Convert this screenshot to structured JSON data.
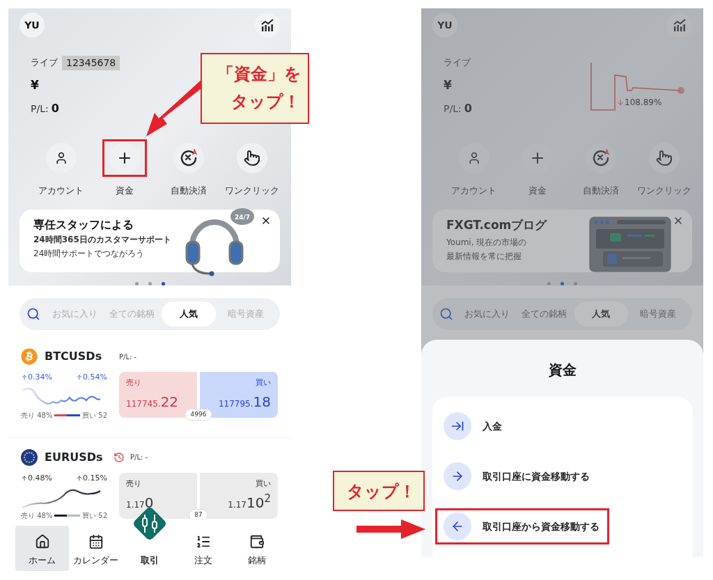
{
  "screens": [
    {
      "dimmed": false,
      "avatar": "YU",
      "account_label": "ライブ",
      "account_number": "12345678",
      "currency": "¥",
      "pl_label": "P/L:",
      "pl_value": "0",
      "actions": [
        {
          "kind": "account",
          "label": "アカウント",
          "highlighted": false
        },
        {
          "kind": "funds",
          "label": "資金",
          "highlighted": true
        },
        {
          "kind": "auto",
          "label": "自動決済",
          "highlighted": false
        },
        {
          "kind": "oneclick",
          "label": "ワンクリック",
          "highlighted": false
        }
      ],
      "banner": {
        "kind": "support",
        "title": "専任スタッフによる",
        "lines": [
          "24時間365日のカスタマーサポート",
          "24時間サポートでつながろう"
        ],
        "badge": "24/7"
      },
      "pager": [
        {
          "selected": false
        },
        {
          "selected": false
        },
        {
          "selected": true
        }
      ],
      "tabs": [
        {
          "label": "お気に入り",
          "selected": false
        },
        {
          "label": "全ての銘柄",
          "selected": false
        },
        {
          "label": "人気",
          "selected": true
        },
        {
          "label": "暗号資産",
          "selected": false
        }
      ],
      "instruments": [
        {
          "kind": "btc",
          "name": "BTCUSDs",
          "pl": "P/L: -",
          "history": false,
          "market_open": true,
          "change_1": "0.34%",
          "change_2": "0.54%",
          "sell_ratio": "売り 48%",
          "buy_ratio": "買い 52",
          "level": 0.48,
          "sell_label": "売り",
          "sell_small": "117745.",
          "sell_large": "22",
          "buy_label": "買い",
          "buy_small": "117795.",
          "buy_large": "18",
          "spread": "4996"
        },
        {
          "kind": "eur",
          "name": "EURUSDs",
          "pl": "P/L: -",
          "history": true,
          "market_open": false,
          "change_1": "0.48%",
          "change_2": "0.15%",
          "sell_ratio": "売り 48%",
          "buy_ratio": "買い 52",
          "level": 0.48,
          "sell_label": "売り",
          "sell_small": "1.17",
          "sell_large": "0",
          "buy_label": "買い",
          "buy_small": "1.17",
          "buy_large": "10$^{2}$",
          "spread": "87"
        }
      ],
      "nav": [
        {
          "kind": "home",
          "label": "ホーム",
          "selected": true
        },
        {
          "kind": "calendar",
          "label": "カレンダー",
          "selected": false
        },
        {
          "kind": "trade",
          "label": "取引",
          "selected": false
        },
        {
          "kind": "orders",
          "label": "注文",
          "selected": false
        },
        {
          "kind": "wallet",
          "label": "銘柄",
          "selected": false
        }
      ]
    },
    {
      "dimmed": true,
      "avatar": "YU",
      "account_label": "ライブ",
      "currency": "¥",
      "pl_label": "P/L:",
      "pl_value": "0",
      "equity_change": "108.89%",
      "actions": [
        {
          "kind": "account",
          "label": "アカウント",
          "highlighted": false
        },
        {
          "kind": "funds",
          "label": "資金",
          "highlighted": false
        },
        {
          "kind": "auto",
          "label": "自動決済",
          "highlighted": false
        },
        {
          "kind": "oneclick",
          "label": "ワンクリック",
          "highlighted": false
        }
      ],
      "banner": {
        "kind": "blog",
        "title": "FXGT.comブログ",
        "lines": [
          "Youmi, 現在の市場の",
          "最新情報を常に把握"
        ]
      },
      "pager": [
        {
          "selected": false
        },
        {
          "selected": true
        },
        {
          "selected": false
        }
      ],
      "tabs": [
        {
          "label": "お気に入り",
          "selected": false
        },
        {
          "label": "全ての銘柄",
          "selected": false
        },
        {
          "label": "人気",
          "selected": true
        },
        {
          "label": "暗号資産",
          "selected": false
        }
      ],
      "sheet": {
        "title": "資金",
        "items": [
          {
            "kind": "deposit",
            "label": "入金",
            "highlighted": false
          },
          {
            "kind": "to_trading",
            "label": "取引口座に資金移動する",
            "highlighted": false
          },
          {
            "kind": "from_trading",
            "label": "取引口座から資金移動する",
            "highlighted": true
          }
        ]
      }
    }
  ],
  "annotations": [
    {
      "kind": "funds_callout",
      "lines": [
        "「資金」を",
        "タップ！"
      ]
    },
    {
      "kind": "sheet_callout",
      "lines": [
        "タップ！"
      ]
    }
  ]
}
